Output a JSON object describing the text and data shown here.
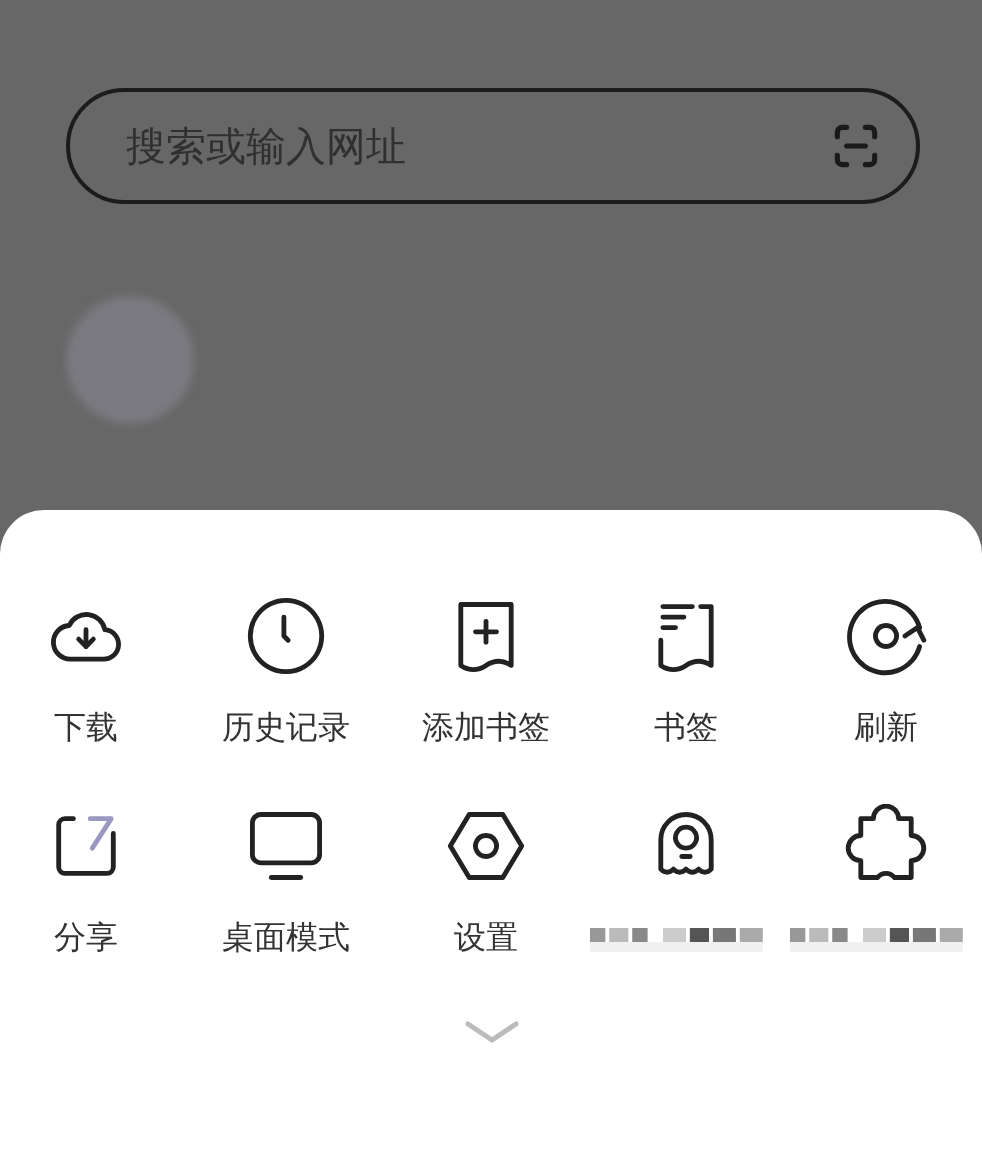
{
  "search": {
    "placeholder": "搜索或输入网址"
  },
  "menu": {
    "items": [
      {
        "label": "下载"
      },
      {
        "label": "历史记录"
      },
      {
        "label": "添加书签"
      },
      {
        "label": "书签"
      },
      {
        "label": "刷新"
      },
      {
        "label": "分享"
      },
      {
        "label": "桌面模式"
      },
      {
        "label": "设置"
      },
      {
        "label_redacted": true
      },
      {
        "label_redacted": true
      }
    ]
  }
}
